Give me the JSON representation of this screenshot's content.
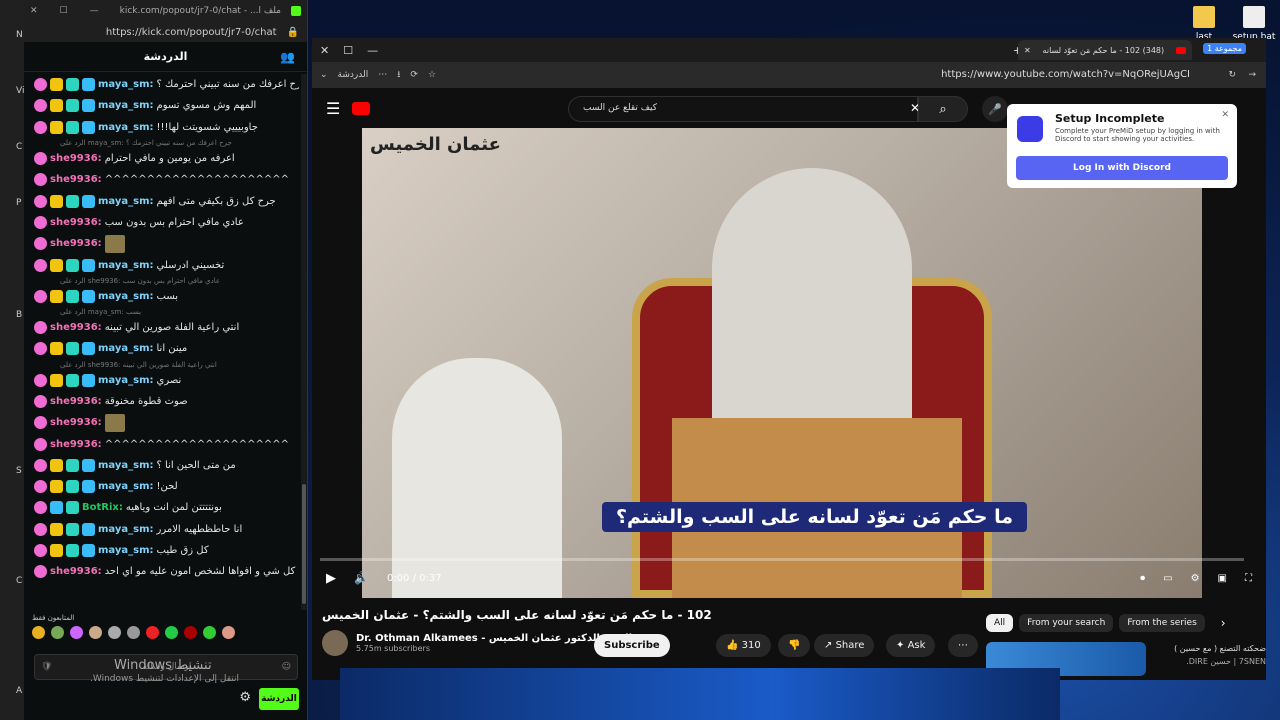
{
  "desktop": {
    "icons": [
      {
        "label": "last"
      },
      {
        "label": "setup.bat"
      }
    ]
  },
  "chat_window": {
    "title": "ملف ا... - kick.com/popout/jr7-0/chat",
    "url": "https://kick.com/popout/jr7-0/chat",
    "header": "الدردشة",
    "messages": [
      {
        "user": "maya_sm:",
        "text": "جرح اعرفك من سنه تبيني احترمك ؟",
        "type": "m"
      },
      {
        "user": "maya_sm:",
        "text": "المهم وش مسوي تسوم",
        "type": "m"
      },
      {
        "user": "maya_sm:",
        "text": "جاوبيييي شسويتت لها!!!",
        "type": "m"
      },
      {
        "reply": "الرد على maya_sm: جرح اعرفك من سنه تبيني احترمك ؟"
      },
      {
        "user": "she9936:",
        "text": "اعرفه من يومين و مافي احترام",
        "type": "s"
      },
      {
        "user": "she9936:",
        "text": "^^^^^^^^^^^^^^^^^^^^^^",
        "type": "s"
      },
      {
        "user": "maya_sm:",
        "text": "جرح كل زق بكيفي متى افهم",
        "type": "m"
      },
      {
        "user": "she9936:",
        "text": "عادي مافي احترام بس بدون سب",
        "type": "s"
      },
      {
        "user": "she9936:",
        "text": "",
        "type": "s",
        "emote": true
      },
      {
        "user": "maya_sm:",
        "text": "تخسيني ادرسلي",
        "type": "m"
      },
      {
        "reply": "الرد على she9936: عادي مافي احترام بس بدون سب"
      },
      {
        "user": "maya_sm:",
        "text": "بسب",
        "type": "m"
      },
      {
        "reply": "الرد على maya_sm: بسب"
      },
      {
        "user": "she9936:",
        "text": "انتي راعية الفلة صورين الي تبينه",
        "type": "s"
      },
      {
        "user": "maya_sm:",
        "text": "مينن انا",
        "type": "m"
      },
      {
        "reply": "الرد على she9936: انتي راعية الفلة صورين الي تبينه"
      },
      {
        "user": "maya_sm:",
        "text": "نصري",
        "type": "m"
      },
      {
        "user": "she9936:",
        "text": "صوت قطوة مخنوقة",
        "type": "s"
      },
      {
        "user": "she9936:",
        "text": "",
        "type": "s",
        "emote": true
      },
      {
        "user": "she9936:",
        "text": "^^^^^^^^^^^^^^^^^^^^^^",
        "type": "s"
      },
      {
        "user": "maya_sm:",
        "text": "من متى الحين انا ؟",
        "type": "m"
      },
      {
        "user": "maya_sm:",
        "text": "لحن!",
        "type": "m"
      },
      {
        "user": "BotRix:",
        "text": "بونتتتتن لمن انت وياهيه",
        "type": "b"
      },
      {
        "user": "maya_sm:",
        "text": "انا حاطظطهيه الامرر",
        "type": "m"
      },
      {
        "user": "maya_sm:",
        "text": "كل زق طيب",
        "type": "m"
      },
      {
        "user": "she9936:",
        "text": "شوف انا حدي كل شي و افواها لشخص امون عليه مو اي احد",
        "type": "s"
      }
    ],
    "viewers_label": "المتابعون فقط",
    "input_placeholder": "إرسال رسالة",
    "send_label": "الدردشة",
    "windows_watermark_1": "تنشيط Windows",
    "windows_watermark_2": "انتقل إلى الإعدادات لتنشيط Windows."
  },
  "browser": {
    "tab_title": "(348) 102 - ما حكم مَن تعوّد لسانه",
    "group_label": "مجموعة 1",
    "bookmark_label": "الدردشة",
    "url": "https://www.youtube.com/watch?v=NqORejUAgCI",
    "search_query": "كيف تقلع عن السب",
    "video": {
      "logo_text": "عثمان الخميس",
      "caption": "ما حكم مَن تعوّد لسانه على السب والشتم؟",
      "time": "0:00 / 0:37",
      "title": "102 - ما حكم مَن تعوّد لسانه على السب والشتم؟ - عثمان الخميس"
    },
    "channel": {
      "name": "Dr. Othman Alkamees - الشيخ الدكتور عثمان الخميس",
      "subscribers": "5.75m subscribers",
      "subscribe": "Subscribe"
    },
    "actions": {
      "likes": "310",
      "share": "Share",
      "ask": "Ask"
    },
    "chips": [
      "All",
      "From your search",
      "From the series"
    ],
    "related": {
      "title": "ضحكته التصنع ( مع حسين )",
      "channel": "7SNEN | حسين DIRE."
    }
  },
  "premid": {
    "title": "Setup Incomplete",
    "desc": "Complete your PreMiD setup by logging in with Discord to start showing your activities.",
    "button": "Log In with Discord"
  }
}
